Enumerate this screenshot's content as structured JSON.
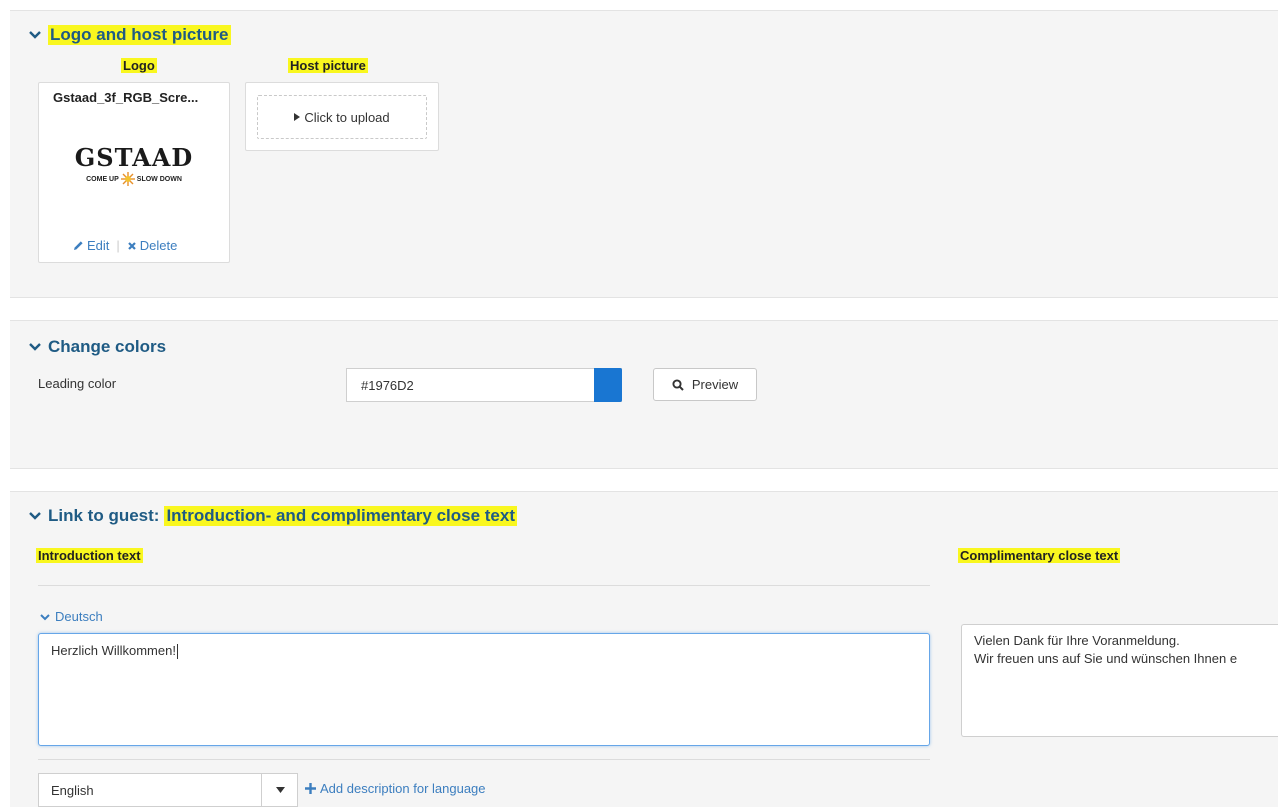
{
  "sections": {
    "logo": {
      "title": "Logo and host picture",
      "logo_label": "Logo",
      "host_label": "Host picture",
      "logo_filename": "Gstaad_3f_RGB_Scre...",
      "logo_brand": "GSTAAD",
      "logo_tagline_left": "COME UP",
      "logo_tagline_right": "SLOW DOWN",
      "edit_label": "Edit",
      "delete_label": "Delete",
      "upload_label": "Click to upload"
    },
    "colors": {
      "title": "Change colors",
      "leading_label": "Leading color",
      "leading_value": "#1976D2",
      "swatch_color": "#1976D2",
      "preview_label": "Preview"
    },
    "texts": {
      "title_prefix": "Link to guest:",
      "title_highlight": "Introduction- and complimentary close text",
      "intro_label": "Introduction text",
      "close_label": "Complimentary close text",
      "language_toggle": "Deutsch",
      "intro_value": "Herzlich Willkommen!",
      "close_line1": "Vielen Dank für Ihre Voranmeldung.",
      "close_line2": "Wir freuen uns auf Sie und wünschen Ihnen e",
      "language_select": "English",
      "add_language_label": "Add description for language"
    }
  },
  "colors": {
    "accent": "#1976D2",
    "title": "#1f5b84",
    "highlight": "#f9f71f",
    "link": "#3c7ebf"
  }
}
